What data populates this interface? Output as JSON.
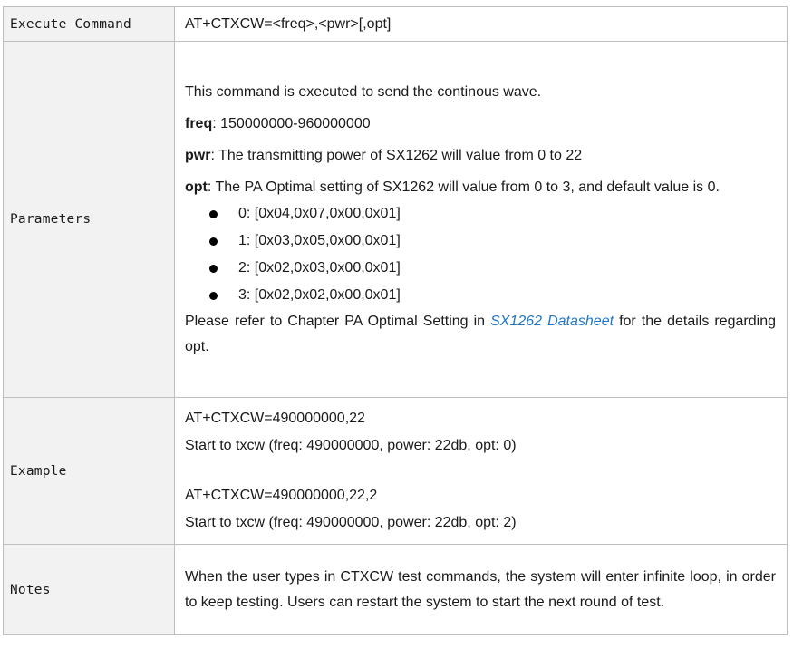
{
  "rows": {
    "execute": {
      "label": "Execute Command",
      "value": "AT+CTXCW=<freq>,<pwr>[,opt]"
    },
    "parameters": {
      "label": "Parameters",
      "intro": "This command is executed to send the continous wave.",
      "freq_key": "freq",
      "freq_text": ": 150000000-960000000",
      "pwr_key": "pwr",
      "pwr_text": ": The transmitting power of SX1262 will value from 0 to 22",
      "opt_key": "opt",
      "opt_text": ": The PA Optimal setting of SX1262 will value from 0 to 3, and default value is 0.",
      "opt_values": [
        "0: [0x04,0x07,0x00,0x01]",
        "1: [0x03,0x05,0x00,0x01]",
        "2: [0x02,0x03,0x00,0x01]",
        "3: [0x02,0x02,0x00,0x01]"
      ],
      "refer_before": "Please refer to Chapter PA Optimal Setting in ",
      "refer_link": "SX1262 Datasheet",
      "refer_after": " for the details regarding opt."
    },
    "example": {
      "label": "Example",
      "lines": [
        "AT+CTXCW=490000000,22",
        "Start to txcw (freq: 490000000, power: 22db, opt: 0)",
        "AT+CTXCW=490000000,22,2",
        "Start to txcw (freq: 490000000, power: 22db, opt: 2)"
      ]
    },
    "notes": {
      "label": "Notes",
      "text": "When the user types in CTXCW test commands, the system will enter infinite loop, in order to keep testing. Users can restart the system to start the next round of test."
    }
  }
}
